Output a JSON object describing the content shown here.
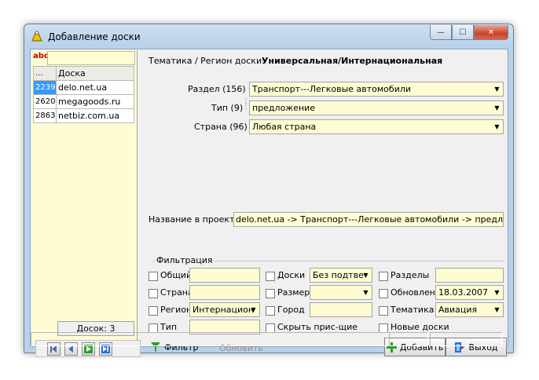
{
  "window": {
    "title": "Добавление доски",
    "min": "—",
    "max": "☐",
    "close": "✕"
  },
  "left": {
    "abc": "abc",
    "grid_header": [
      "...",
      "Доска"
    ],
    "rows": [
      {
        "id": "2239",
        "name": "delo.net.ua"
      },
      {
        "id": "2620",
        "name": "megagoods.ru"
      },
      {
        "id": "2863",
        "name": "netbiz.com.ua"
      }
    ],
    "count": "Досок: 3"
  },
  "theme": {
    "label": "Тематика / Регион доски:",
    "value": "Универсальная/Интернациональная"
  },
  "section": {
    "label": "Раздел (156)",
    "value": "Транспорт---Легковые автомобили"
  },
  "type": {
    "label": "Тип (9)",
    "value": "предложение"
  },
  "country": {
    "label": "Страна (96)",
    "value": "Любая страна"
  },
  "project": {
    "label": "Название в проекте:",
    "value": "delo.net.ua -> Транспорт---Легковые автомобили -> предложение ->"
  },
  "filter": {
    "group_label": "Фильтрация",
    "general": "Общий",
    "country": "Страна",
    "region": "Регион",
    "region_value": "Интернацион",
    "type": "Тип",
    "boards": "Доски",
    "boards_value": "Без подтве",
    "size": "Размер",
    "city": "Город",
    "hide": "Скрыть прис-щие",
    "sections": "Разделы",
    "updated": "Обновлен.",
    "updated_value": "18.03.2007",
    "theme": "Тематика",
    "theme_value": "Авиация",
    "new_boards": "Новые доски"
  },
  "buttons": {
    "filter": "Фильтр",
    "refresh": "Обновить",
    "add": "Добавить",
    "exit": "Выход"
  }
}
